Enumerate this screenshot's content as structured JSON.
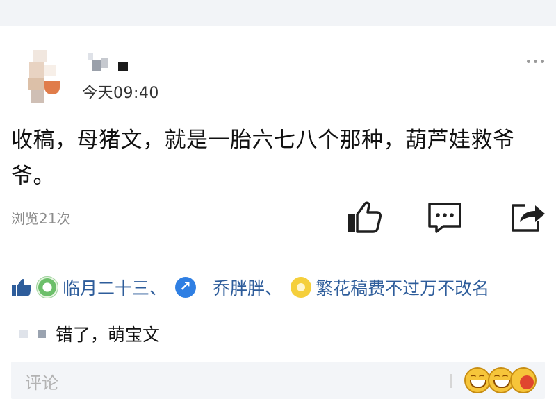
{
  "post": {
    "time": "今天09:40",
    "text": "收稿，母猪文，就是一胎六七八个那种，葫芦娃救爷爷。",
    "views": "浏览21次"
  },
  "icons": {
    "more": "more-dots-icon",
    "like": "thumbs-up-icon",
    "comment": "comment-icon",
    "share": "share-icon"
  },
  "likes": {
    "users": [
      "临月二十三",
      "乔胖胖",
      "繁花稿费不过万不改名"
    ],
    "separator": "、"
  },
  "comment": {
    "text": "错了，萌宝文"
  },
  "input": {
    "placeholder": "评论"
  },
  "colors": {
    "accent_blue": "#2e5d9b",
    "muted": "#8c8c8c"
  }
}
